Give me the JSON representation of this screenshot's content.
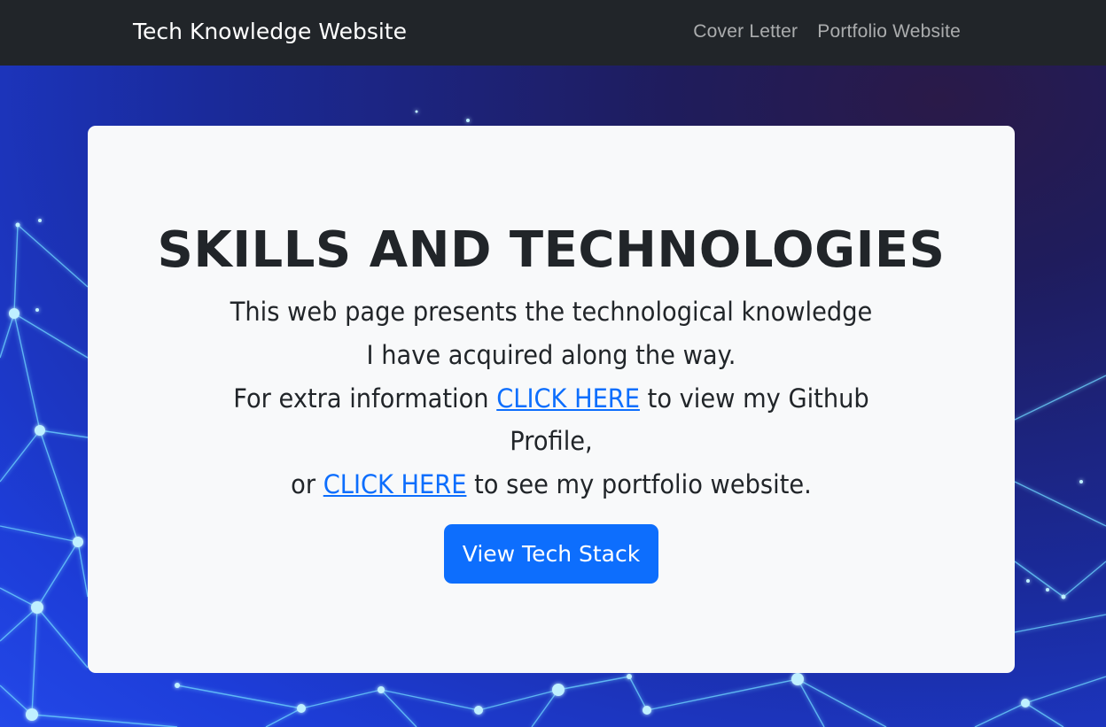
{
  "navbar": {
    "brand": "Tech Knowledge Website",
    "links": [
      "Cover Letter",
      "Portfolio Website"
    ]
  },
  "hero": {
    "title": "SKILLS AND TECHNOLOGIES",
    "line1": "This web page presents the technological knowledge",
    "line2": "I have acquired along the way.",
    "line3_prefix": "For extra information",
    "github_link": "CLICK HERE",
    "line3_suffix": "to view my Github",
    "line4": "Profile,",
    "line5_prefix": "or",
    "portfolio_link": "CLICK HERE",
    "line5_suffix": "to see my portfolio website.",
    "button_label": "View Tech Stack"
  },
  "colors": {
    "navbar_bg": "#212529",
    "card_bg": "#f8f9fa",
    "accent": "#0d6efd",
    "text": "#212529",
    "network_glow": "#6fd6ff"
  }
}
